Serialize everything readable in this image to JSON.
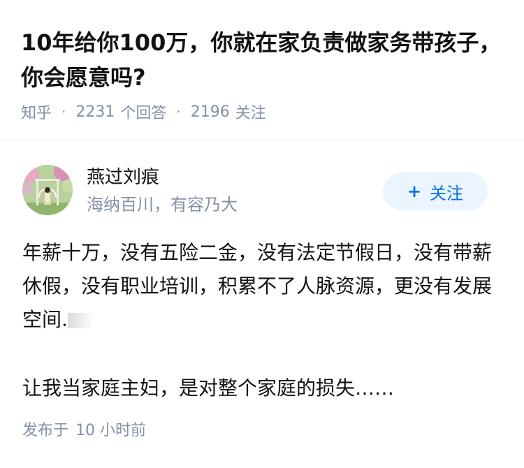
{
  "question": {
    "title": "10年给你100万，你就在家负责做家务带孩子，你会愿意吗?",
    "source": "知乎",
    "answer_count": "2231",
    "answer_count_label": "个回答",
    "follower_count": "2196",
    "follower_count_label": "关注"
  },
  "author": {
    "name": "燕过刘痕",
    "headline": "海纳百川，有容乃大",
    "avatar_icon": "avatar-photo",
    "follow_label": "关注",
    "follow_icon": "plus-icon"
  },
  "answer": {
    "paragraph_1": "年薪十万，没有五险二金，没有法定节假日，没有带薪休假，没有职业培训，积累不了人脉资源，更没有发展空间.",
    "paragraph_2": "让我当家庭主妇，是对整个家庭的损失……",
    "published_prefix": "发布于",
    "published_time": "10 小时前"
  },
  "colors": {
    "text_primary": "#121212",
    "text_secondary": "#8590a6",
    "accent": "#056de8",
    "follow_bg": "#ebf5ff",
    "divider": "#f0f2f5"
  }
}
